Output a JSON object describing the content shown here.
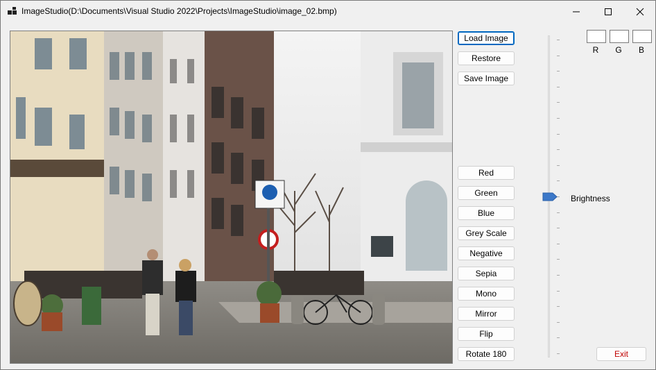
{
  "window": {
    "title": "ImageStudio(D:\\Documents\\Visual Studio 2022\\Projects\\ImageStudio\\image_02.bmp)"
  },
  "buttons": {
    "load": "Load Image",
    "restore": "Restore",
    "save": "Save Image",
    "red": "Red",
    "green": "Green",
    "blue": "Blue",
    "grey": "Grey Scale",
    "negative": "Negative",
    "sepia": "Sepia",
    "mono": "Mono",
    "mirror": "Mirror",
    "flip": "Flip",
    "rotate": "Rotate 180",
    "exit": "Exit"
  },
  "rgb": {
    "r_label": "R",
    "g_label": "G",
    "b_label": "B",
    "r_value": "",
    "g_value": "",
    "b_value": ""
  },
  "brightness": {
    "label": "Brightness",
    "level": 0.5
  },
  "icons": {
    "app": "app-icon",
    "minimize": "minimize-icon",
    "maximize": "maximize-icon",
    "close": "close-icon",
    "slider_thumb": "slider-thumb-icon"
  },
  "colors": {
    "exit_text": "#c00000",
    "accent_border": "#0067c0",
    "slider_thumb": "#3c78c8"
  }
}
